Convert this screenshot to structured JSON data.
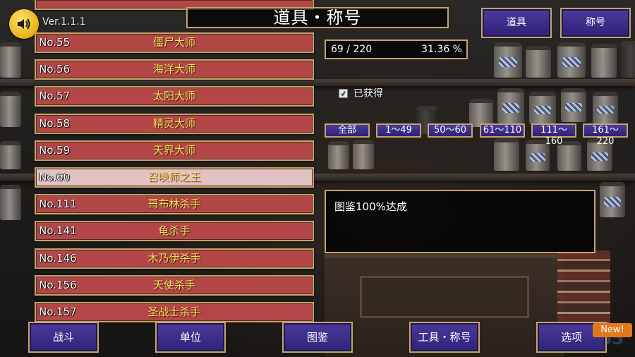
{
  "header": {
    "version": "Ver.1.1.1",
    "title": "道具・称号",
    "sound_icon": "speaker-icon"
  },
  "tabs": [
    {
      "label": "道具"
    },
    {
      "label": "称号"
    }
  ],
  "progress": {
    "count": "69 / 220",
    "percent": "31.36 %"
  },
  "filter_obtained": {
    "label": "已获得",
    "checked": true
  },
  "filters": [
    "全部",
    "1～49",
    "50～60",
    "61～110",
    "111～160",
    "161～220"
  ],
  "description": "图鉴100%达成",
  "titles": [
    {
      "no": "No.55",
      "name": "僵尸大师"
    },
    {
      "no": "No.56",
      "name": "海洋大师"
    },
    {
      "no": "No.57",
      "name": "太阳大师"
    },
    {
      "no": "No.58",
      "name": "精灵大师"
    },
    {
      "no": "No.59",
      "name": "天界大师"
    },
    {
      "no": "No.60",
      "name": "召唤师之王"
    },
    {
      "no": "No.111",
      "name": "哥布林杀手"
    },
    {
      "no": "No.141",
      "name": "龟杀手"
    },
    {
      "no": "No.146",
      "name": "木乃伊杀手"
    },
    {
      "no": "No.156",
      "name": "天使杀手"
    },
    {
      "no": "No.157",
      "name": "圣战士杀手"
    }
  ],
  "selected_title": "No.60",
  "bottom_nav": [
    {
      "label": "战斗"
    },
    {
      "label": "单位"
    },
    {
      "label": "图鉴"
    },
    {
      "label": "工具・称号"
    },
    {
      "label": "选项"
    }
  ],
  "new_badge": "New!",
  "watermark": "2265"
}
